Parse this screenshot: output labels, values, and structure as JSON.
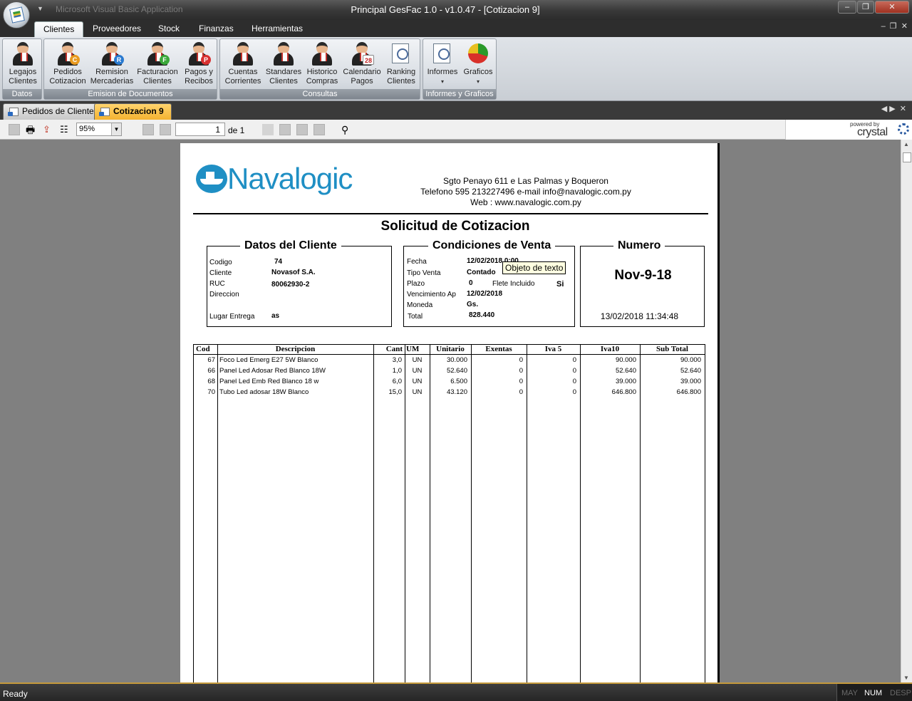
{
  "window": {
    "title": "Principal GesFac 1.0 - v1.0.47 - [Cotizacion 9]",
    "faint_caption": "Microsoft Visual Basic Application",
    "minimize": "–",
    "restore": "❐",
    "close": "✕"
  },
  "ribbon": {
    "tabs": [
      "Clientes",
      "Proveedores",
      "Stock",
      "Finanzas",
      "Herramientas"
    ],
    "active_tab": "Clientes",
    "groups": {
      "datos": {
        "label": "Datos",
        "buttons": [
          {
            "l1": "Legajos",
            "l2": "Clientes"
          }
        ]
      },
      "emision": {
        "label": "Emision de Documentos",
        "buttons": [
          {
            "l1": "Pedidos",
            "l2": "Cotizacion",
            "badge": "C",
            "color": "#e89a20"
          },
          {
            "l1": "Remision",
            "l2": "Mercaderias",
            "badge": "R",
            "color": "#2a7ad0"
          },
          {
            "l1": "Facturacion",
            "l2": "Clientes",
            "badge": "F",
            "color": "#3aa83a"
          },
          {
            "l1": "Pagos y",
            "l2": "Recibos",
            "badge": "P",
            "color": "#d83030"
          }
        ]
      },
      "consultas": {
        "label": "Consultas",
        "buttons": [
          {
            "l1": "Cuentas",
            "l2": "Corrientes"
          },
          {
            "l1": "Standares",
            "l2": "Clientes"
          },
          {
            "l1": "Historico",
            "l2": "Compras"
          },
          {
            "l1": "Calendario",
            "l2": "Pagos",
            "badge": "28"
          },
          {
            "l1": "Ranking",
            "l2": "Clientes"
          }
        ]
      },
      "informes": {
        "label": "Informes y Graficos",
        "buttons": [
          {
            "l1": "Informes",
            "l2": "▾"
          },
          {
            "l1": "Graficos",
            "l2": "▾"
          }
        ]
      }
    }
  },
  "doc_tabs": [
    {
      "label": "Pedidos de Clientes",
      "active": false
    },
    {
      "label": "Cotizacion 9",
      "active": true
    }
  ],
  "viewer_toolbar": {
    "zoom": "95%",
    "page_current": "1",
    "page_of": "de 1",
    "powered_by": "powered by",
    "brand": "crystal"
  },
  "report": {
    "company": "Navalogic",
    "address": "Sgto Penayo 611 e Las Palmas y Boqueron",
    "phone": "Telefono 595 213227496 e-mail info@navalogic.com.py",
    "web": "Web : www.navalogic.com.py",
    "title": "Solicitud de Cotizacion",
    "cliente": {
      "heading": "Datos del Cliente",
      "codigo_label": "Codigo",
      "codigo": "74",
      "cliente_label": "Cliente",
      "cliente": "Novasof S.A.",
      "ruc_label": "RUC",
      "ruc": "80062930-2",
      "direccion_label": "Direccion",
      "lugar_label": "Lugar Entrega",
      "lugar": "as"
    },
    "condiciones": {
      "heading": "Condiciones de Venta",
      "fecha_label": "Fecha",
      "fecha": "12/02/2018   0:00",
      "tipo_label": "Tipo Venta",
      "tipo": "Contado",
      "plazo_label": "Plazo",
      "plazo": "0",
      "flete_label": "Flete Incluido",
      "flete": "Si",
      "venc_label": "Vencimiento Ap",
      "venc": "12/02/2018",
      "moneda_label": "Moneda",
      "moneda": "Gs.",
      "total_label": "Total",
      "total": "828.440"
    },
    "numero": {
      "heading": "Numero",
      "value": "Nov-9-18",
      "timestamp": "13/02/2018 11:34:48"
    },
    "tooltip": "Objeto de texto",
    "columns": [
      "Cod",
      "Descripcion",
      "Cant",
      "UM",
      "Unitario",
      "Exentas",
      "Iva 5",
      "Iva10",
      "Sub Total"
    ],
    "rows": [
      [
        "67",
        "Foco Led Emerg E27 5W Blanco",
        "3,0",
        "UN",
        "30.000",
        "0",
        "0",
        "90.000",
        "90.000"
      ],
      [
        "66",
        "Panel Led Adosar Red Blanco 18W",
        "1,0",
        "UN",
        "52.640",
        "0",
        "0",
        "52.640",
        "52.640"
      ],
      [
        "68",
        "Panel Led Emb Red Blanco 18 w",
        "6,0",
        "UN",
        "6.500",
        "0",
        "0",
        "39.000",
        "39.000"
      ],
      [
        "70",
        "Tubo Led adosar 18W Blanco",
        "15,0",
        "UN",
        "43.120",
        "0",
        "0",
        "646.800",
        "646.800"
      ]
    ]
  },
  "status": {
    "text": "Ready",
    "may": "MAY",
    "num": "NUM",
    "desp": "DESP"
  }
}
